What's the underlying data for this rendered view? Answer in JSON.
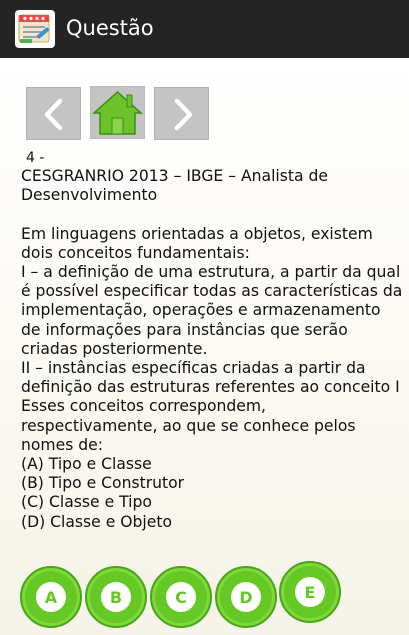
{
  "header": {
    "title": "Questão",
    "app_icon": "notebook-icon"
  },
  "nav": {
    "prev_icon": "chevron-left-icon",
    "home_icon": "home-icon",
    "next_icon": "chevron-right-icon"
  },
  "question": {
    "number": "4 -",
    "text": "CESGRANRIO 2013 – IBGE – Analista de Desenvolvimento\n\nEm linguagens orientadas a objetos, existem dois conceitos fundamentais:\nI – a definição de uma estrutura, a partir da qual é possível especificar todas as características da implementação, operações e armazenamento de informações para instâncias que serão criadas posteriormente.\nII – instâncias específicas criadas a partir da definição das estruturas referentes ao conceito I\nEsses conceitos correspondem, respectivamente, ao que se conhece pelos nomes de:\n(A) Tipo e Classe\n(B) Tipo e Construtor\n(C) Classe e Tipo\n(D) Classe e Objeto"
  },
  "answers": [
    {
      "letter": "A"
    },
    {
      "letter": "B"
    },
    {
      "letter": "C"
    },
    {
      "letter": "D"
    },
    {
      "letter": "E"
    }
  ],
  "colors": {
    "action_bar": "#242424",
    "answer_green": "#66c825",
    "nav_gray": "#c4c4c4"
  }
}
